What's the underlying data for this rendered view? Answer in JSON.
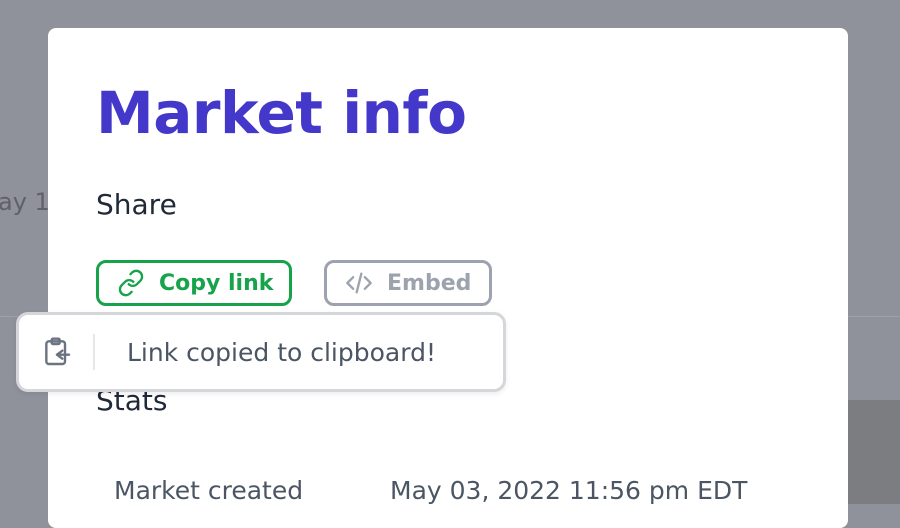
{
  "background": {
    "partial_text": "ay 1"
  },
  "modal": {
    "title": "Market info",
    "share_label": "Share",
    "copy_link_label": "Copy link",
    "embed_label": "Embed",
    "stats_label": "Stats",
    "stats": [
      {
        "label": "Market created",
        "value": "May 03, 2022 11:56 pm EDT"
      }
    ]
  },
  "toast": {
    "message": "Link copied to clipboard!",
    "icon": "clipboard-check-icon"
  },
  "colors": {
    "title": "#4338ca",
    "copy_accent": "#16a34a",
    "embed_muted": "#9ca3af",
    "overlay": "#8f929b"
  }
}
